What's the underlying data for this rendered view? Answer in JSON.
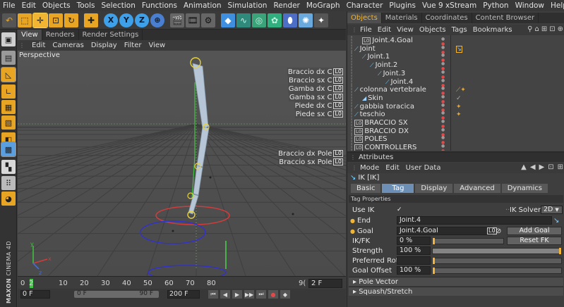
{
  "menu": [
    "File",
    "Edit",
    "Objects",
    "Tools",
    "Selection",
    "Functions",
    "Animation",
    "Simulation",
    "Render",
    "MoGraph",
    "Character",
    "Plugins",
    "Vue 9 xStream",
    "Python",
    "Window",
    "Help"
  ],
  "toolbar_icons": [
    "undo-icon",
    "live-selection-icon",
    "move-icon",
    "scale-icon",
    "rotate-icon",
    "add-icon",
    "x-axis-icon",
    "y-axis-icon",
    "z-axis-icon",
    "coordinate-system-icon",
    "render-view-icon",
    "render-picture-icon",
    "render-settings-icon",
    "cube-icon",
    "spline-icon",
    "nurbs-icon",
    "array-icon",
    "deformer-icon",
    "scene-icon",
    "light-icon"
  ],
  "toolbar_glyphs": {
    "x": "X",
    "y": "Y",
    "z": "Z"
  },
  "viewport": {
    "tabs": [
      "View",
      "Renders",
      "Render Settings"
    ],
    "active_tab": "View",
    "menu": [
      "Edit",
      "Cameras",
      "Display",
      "Filter",
      "View"
    ],
    "label": "Perspective",
    "controllers_top": [
      "Braccio dx C",
      "Braccio sx C",
      "Gamba dx C",
      "Gamba sx C",
      "Piede dx C",
      "Piede sx C"
    ],
    "controllers_pole": [
      "Braccio dx Pole",
      "Braccio sx Pole"
    ],
    "null_glyph": "L0"
  },
  "timeline": {
    "ticks": [
      "0",
      "2",
      "10",
      "20",
      "30",
      "40",
      "50",
      "60",
      "70",
      "80",
      "9("
    ],
    "frame_field": "2 F",
    "current_frame": 2,
    "start_field": "0 F",
    "range_start": "0 F",
    "range_end": "90 F",
    "end_field": "200 F"
  },
  "objects_panel": {
    "tabs": [
      "Objects",
      "Materials",
      "Coordinates",
      "Content Browser"
    ],
    "active_tab": "Objects",
    "menu": [
      "File",
      "Edit",
      "View",
      "Objects",
      "Tags",
      "Bookmarks"
    ],
    "items": [
      {
        "name": "Joint.4.Goal",
        "type": "null",
        "indent": 1
      },
      {
        "name": "Joint",
        "type": "joint",
        "indent": 0
      },
      {
        "name": "Joint.1",
        "type": "joint",
        "indent": 1
      },
      {
        "name": "Joint.2",
        "type": "joint",
        "indent": 2
      },
      {
        "name": "Joint.3",
        "type": "joint",
        "indent": 3
      },
      {
        "name": "Joint.4",
        "type": "joint",
        "indent": 4
      },
      {
        "name": "colonna vertebrale",
        "type": "joint",
        "indent": 0
      },
      {
        "name": "Skin",
        "type": "skin",
        "indent": 1
      },
      {
        "name": "gabbia toracica",
        "type": "joint",
        "indent": 0
      },
      {
        "name": "teschio",
        "type": "joint",
        "indent": 0
      },
      {
        "name": "BRACCIO SX",
        "type": "null",
        "indent": 0
      },
      {
        "name": "BRACCIO DX",
        "type": "null",
        "indent": 0
      },
      {
        "name": "POLES",
        "type": "null",
        "indent": 0
      },
      {
        "name": "CONTROLLERS",
        "type": "null",
        "indent": 0
      }
    ]
  },
  "attributes": {
    "header": "Attributes",
    "menu": [
      "Mode",
      "Edit",
      "User Data"
    ],
    "object": "IK [IK]",
    "tabs": [
      "Basic",
      "Tag",
      "Display",
      "Advanced",
      "Dynamics"
    ],
    "active_tab": "Tag",
    "section": "Tag Properties",
    "use_ik_label": "Use IK",
    "use_ik_check": "✓",
    "ik_solver_label": "IK Solver",
    "ik_solver_value": "2D",
    "end_label": "End",
    "end_value": "Joint.4",
    "goal_label": "Goal",
    "goal_value": "Joint.4.Goal",
    "add_goal": "Add Goal",
    "ikfk_label": "IK/FK",
    "ikfk_value": "0 %",
    "ikfk_level": 0,
    "reset_fk": "Reset FK",
    "strength_label": "Strength",
    "strength_value": "100 %",
    "strength_level": 100,
    "pref_rot_label": "Preferred Rot",
    "pref_rot_value": "",
    "pref_rot_level": 0,
    "goal_offset_label": "Goal Offset",
    "goal_offset_value": "100 %",
    "goal_offset_level": 0,
    "pole_vector": "Pole Vector",
    "squash_stretch": "Squash/Stretch"
  },
  "brand": {
    "maxon": "MAXON",
    "cinema": "CINEMA 4D"
  },
  "colors": {
    "accent": "#f2b531",
    "bone": "#b6c6d6",
    "green_axis": "#3fc43f",
    "red_circle": "#d23c3c",
    "blue_circle": "#3232c8"
  }
}
